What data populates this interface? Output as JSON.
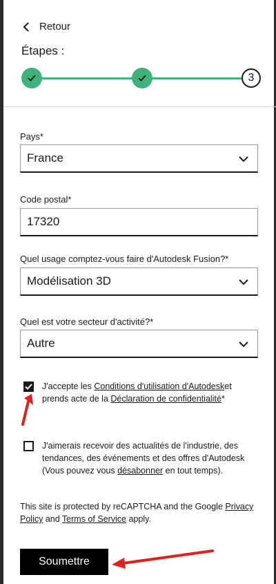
{
  "back": {
    "label": "Retour"
  },
  "steps": {
    "title": "Étapes :",
    "current_step": "3"
  },
  "country": {
    "label": "Pays*",
    "value": "France"
  },
  "postal": {
    "label": "Code postal*",
    "value": "17320"
  },
  "usage": {
    "label": "Quel usage comptez-vous faire d'Autodesk Fusion?*",
    "value": "Modélisation 3D"
  },
  "sector": {
    "label": "Quel est votre secteur d'activité?*",
    "value": "Autre"
  },
  "terms": {
    "checked": true,
    "text_1": "J'accepte les ",
    "link_1": "Conditions d'utilisation d'Autodesk",
    "text_2": "et prends acte de la ",
    "link_2": "Déclaration de confidentialité",
    "text_3": "*"
  },
  "news": {
    "checked": false,
    "text_1": "J'aimerais recevoir des actualités de l'industrie, des tendances, des événements et des offres d'Autodesk (Vous pouvez vous ",
    "link_1": "désabonner",
    "text_2": " en tout temps)."
  },
  "recaptcha": {
    "text_1": "This site is protected by reCAPTCHA and the Google ",
    "link_1": "Privacy Policy",
    "text_2": " and ",
    "link_2": "Terms of Service",
    "text_3": " apply."
  },
  "submit": {
    "label": "Soumettre"
  },
  "colors": {
    "accent_green": "#3fb17a",
    "annotation_red": "#e0201b",
    "button_black": "#000000"
  },
  "icons": [
    "chevron-left-icon",
    "check-icon",
    "chevron-down-icon",
    "red-arrow-annotation"
  ]
}
